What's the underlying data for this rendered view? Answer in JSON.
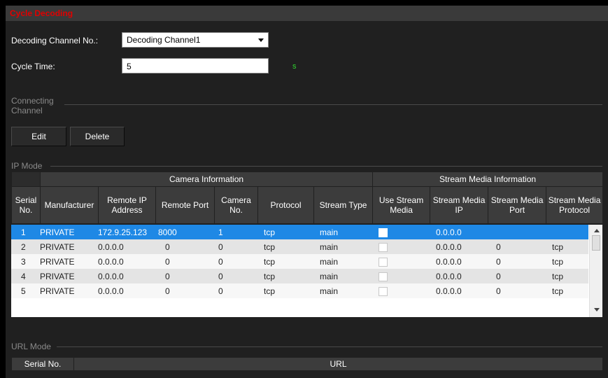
{
  "header": {
    "title": "Cycle Decoding"
  },
  "form": {
    "channel_label": "Decoding Channel No.:",
    "channel_value": "Decoding Channel1",
    "cycle_label": "Cycle Time:",
    "cycle_value": "5",
    "cycle_unit": "s"
  },
  "connecting": {
    "label_line1": "Connecting",
    "label_line2": "Channel",
    "edit_label": "Edit",
    "delete_label": "Delete"
  },
  "ip_mode": {
    "label": "IP Mode",
    "group_camera": "Camera Information",
    "group_stream": "Stream Media Information",
    "columns": [
      "Serial No.",
      "Manufacturer",
      "Remote IP Address",
      "Remote Port",
      "Camera No.",
      "Protocol",
      "Stream Type",
      "Use Stream Media",
      "Stream Media IP",
      "Stream Media Port",
      "Stream Media Protocol"
    ],
    "rows": [
      {
        "serial": "1",
        "manufacturer": "PRIVATE",
        "ip": "172.9.25.123",
        "port": "8000",
        "camera": "1",
        "protocol": "tcp",
        "stream": "main",
        "sm_ip": "0.0.0.0",
        "sm_port": "",
        "sm_proto": ""
      },
      {
        "serial": "2",
        "manufacturer": "PRIVATE",
        "ip": "0.0.0.0",
        "port": "0",
        "camera": "0",
        "protocol": "tcp",
        "stream": "main",
        "sm_ip": "0.0.0.0",
        "sm_port": "0",
        "sm_proto": "tcp"
      },
      {
        "serial": "3",
        "manufacturer": "PRIVATE",
        "ip": "0.0.0.0",
        "port": "0",
        "camera": "0",
        "protocol": "tcp",
        "stream": "main",
        "sm_ip": "0.0.0.0",
        "sm_port": "0",
        "sm_proto": "tcp"
      },
      {
        "serial": "4",
        "manufacturer": "PRIVATE",
        "ip": "0.0.0.0",
        "port": "0",
        "camera": "0",
        "protocol": "tcp",
        "stream": "main",
        "sm_ip": "0.0.0.0",
        "sm_port": "0",
        "sm_proto": "tcp"
      },
      {
        "serial": "5",
        "manufacturer": "PRIVATE",
        "ip": "0.0.0.0",
        "port": "0",
        "camera": "0",
        "protocol": "tcp",
        "stream": "main",
        "sm_ip": "0.0.0.0",
        "sm_port": "0",
        "sm_proto": "tcp"
      }
    ]
  },
  "url_mode": {
    "label": "URL Mode",
    "col_serial": "Serial No.",
    "col_url": "URL"
  },
  "colors": {
    "title": "#e00000",
    "unit": "#2fd42f",
    "selected_row": "#1e88e5"
  }
}
